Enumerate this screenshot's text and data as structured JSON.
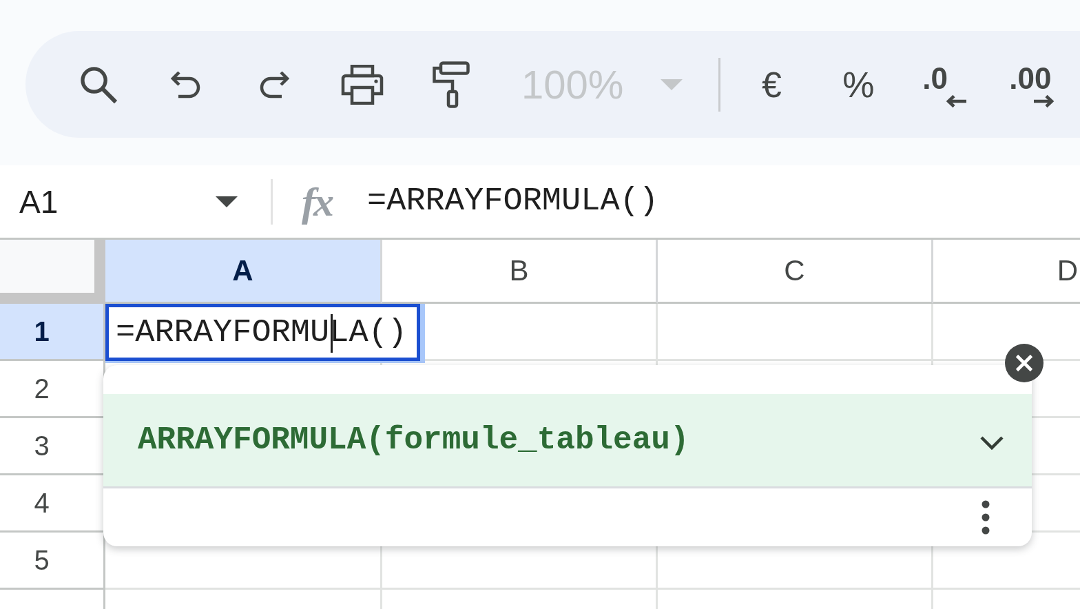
{
  "toolbar": {
    "tools": [
      {
        "kind": "search"
      },
      {
        "kind": "undo"
      },
      {
        "kind": "redo"
      },
      {
        "kind": "print"
      },
      {
        "kind": "paint_format"
      }
    ],
    "zoom": {
      "value": "100%",
      "disabled": true
    },
    "format": [
      {
        "kind": "currency",
        "label": "€"
      },
      {
        "kind": "percent",
        "label": "%"
      },
      {
        "kind": "decimal_decrease",
        "label": ".0"
      },
      {
        "kind": "decimal_increase",
        "label": ".00"
      }
    ]
  },
  "formula_bar": {
    "name_box": "A1",
    "label": "fx",
    "value": "=ARRAYFORMULA()"
  },
  "grid": {
    "columns": [
      {
        "label": "A",
        "selected": true
      },
      {
        "label": "B",
        "selected": false
      },
      {
        "label": "C",
        "selected": false
      },
      {
        "label": "D",
        "selected": false
      }
    ],
    "rows": [
      {
        "label": "1",
        "selected": true
      },
      {
        "label": "2",
        "selected": false
      },
      {
        "label": "3",
        "selected": false
      },
      {
        "label": "4",
        "selected": false
      },
      {
        "label": "5",
        "selected": false
      }
    ],
    "editor": {
      "value": "=ARRAYFORMULA()"
    }
  },
  "autocomplete": {
    "suggestion": "ARRAYFORMULA(formule_tableau)",
    "expanded": false
  }
}
